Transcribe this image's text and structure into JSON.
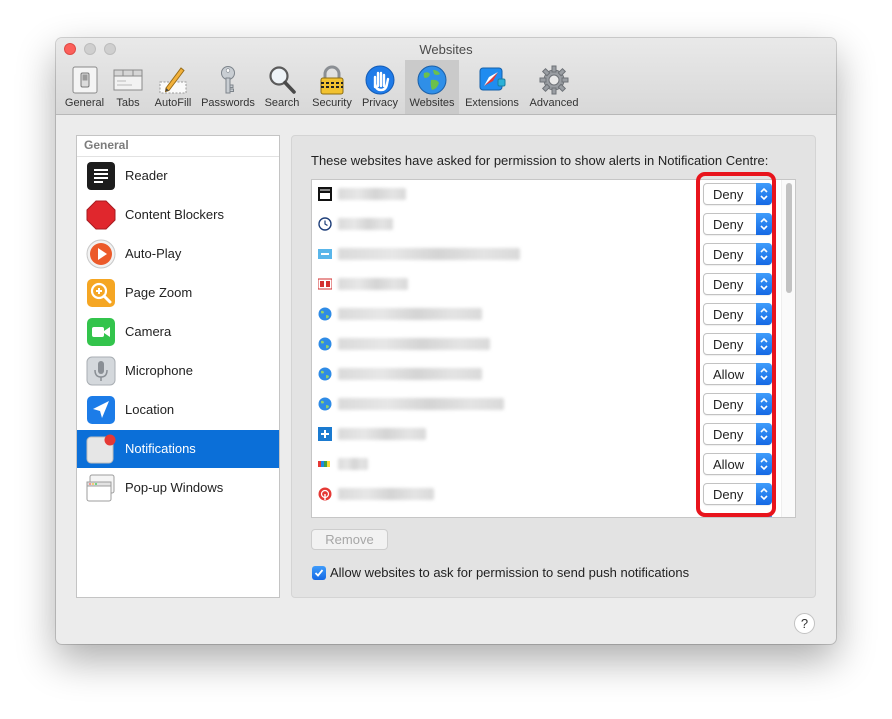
{
  "window": {
    "title": "Websites"
  },
  "toolbar": {
    "items": [
      {
        "label": "General",
        "icon": "general-switch-icon"
      },
      {
        "label": "Tabs",
        "icon": "tabs-icon"
      },
      {
        "label": "AutoFill",
        "icon": "autofill-pencil-icon"
      },
      {
        "label": "Passwords",
        "icon": "key-icon"
      },
      {
        "label": "Search",
        "icon": "magnifier-icon"
      },
      {
        "label": "Security",
        "icon": "lock-icon"
      },
      {
        "label": "Privacy",
        "icon": "hand-icon"
      },
      {
        "label": "Websites",
        "icon": "globe-icon",
        "active": true
      },
      {
        "label": "Extensions",
        "icon": "compass-puzzle-icon"
      },
      {
        "label": "Advanced",
        "icon": "gear-icon"
      }
    ]
  },
  "sidebar": {
    "header": "General",
    "items": [
      {
        "label": "Reader",
        "icon": "reader-icon"
      },
      {
        "label": "Content Blockers",
        "icon": "stop-sign-icon"
      },
      {
        "label": "Auto-Play",
        "icon": "play-icon"
      },
      {
        "label": "Page Zoom",
        "icon": "zoom-icon"
      },
      {
        "label": "Camera",
        "icon": "camera-icon"
      },
      {
        "label": "Microphone",
        "icon": "microphone-icon"
      },
      {
        "label": "Location",
        "icon": "location-arrow-icon"
      },
      {
        "label": "Notifications",
        "icon": "notifications-icon",
        "selected": true
      },
      {
        "label": "Pop-up Windows",
        "icon": "popup-windows-icon"
      }
    ]
  },
  "main": {
    "description": "These websites have asked for permission to show alerts in Notification Centre:",
    "websites": [
      {
        "favicon": "iso-favicon",
        "value": "Deny"
      },
      {
        "favicon": "clock-favicon",
        "value": "Deny"
      },
      {
        "favicon": "blue-badge-favicon",
        "value": "Deny"
      },
      {
        "favicon": "red-bh-favicon",
        "value": "Deny"
      },
      {
        "favicon": "globe-favicon",
        "value": "Deny"
      },
      {
        "favicon": "globe-favicon",
        "value": "Deny"
      },
      {
        "favicon": "globe-favicon",
        "value": "Allow"
      },
      {
        "favicon": "globe-favicon",
        "value": "Deny"
      },
      {
        "favicon": "blue-plus-favicon",
        "value": "Deny"
      },
      {
        "favicon": "rainbow-favicon",
        "value": "Allow"
      },
      {
        "favicon": "red-broadcast-favicon",
        "value": "Deny"
      }
    ],
    "remove_label": "Remove",
    "allow_checkbox": {
      "label": "Allow websites to ask for permission to send push notifications",
      "checked": true
    },
    "help_label": "?"
  },
  "colors": {
    "selection": "#0b6fd8",
    "highlight": "#e8141c",
    "popup_accent": "#1468e4"
  }
}
